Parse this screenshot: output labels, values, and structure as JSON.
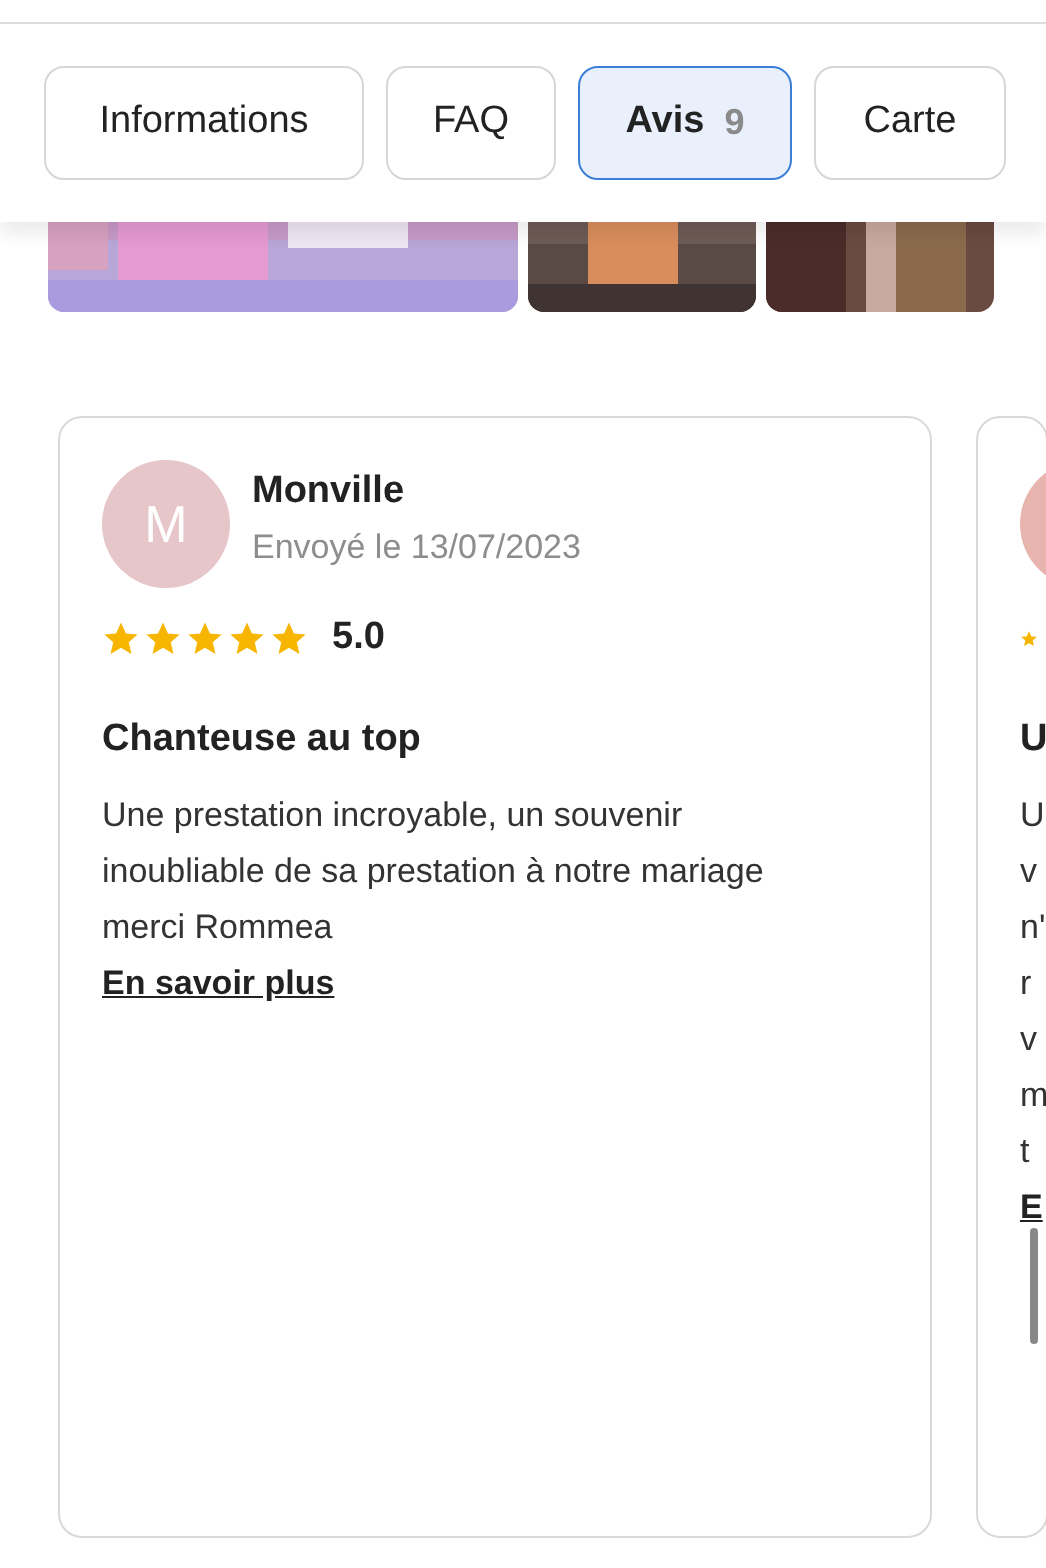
{
  "tabs": [
    {
      "label": "Informations",
      "selected": false
    },
    {
      "label": "FAQ",
      "selected": false
    },
    {
      "label": "Avis",
      "count": "9",
      "selected": true
    },
    {
      "label": "Carte",
      "selected": false
    }
  ],
  "reviews": [
    {
      "initial": "M",
      "color": "#e6c6c8",
      "author": "Monville",
      "date": "Envoyé le 13/07/2023",
      "stars": 5,
      "rating": "5.0",
      "title": "Chanteuse au top",
      "body": [
        "Une prestation incroyable, un souvenir",
        "inoubliable de sa prestation à notre mariage",
        "merci Rommea"
      ],
      "more": "En savoir plus"
    },
    {
      "color": "#e8b4ae",
      "title": "U",
      "body": [
        "U",
        "v",
        "n'",
        "r",
        "v",
        "m",
        "t"
      ],
      "more": "E"
    }
  ]
}
